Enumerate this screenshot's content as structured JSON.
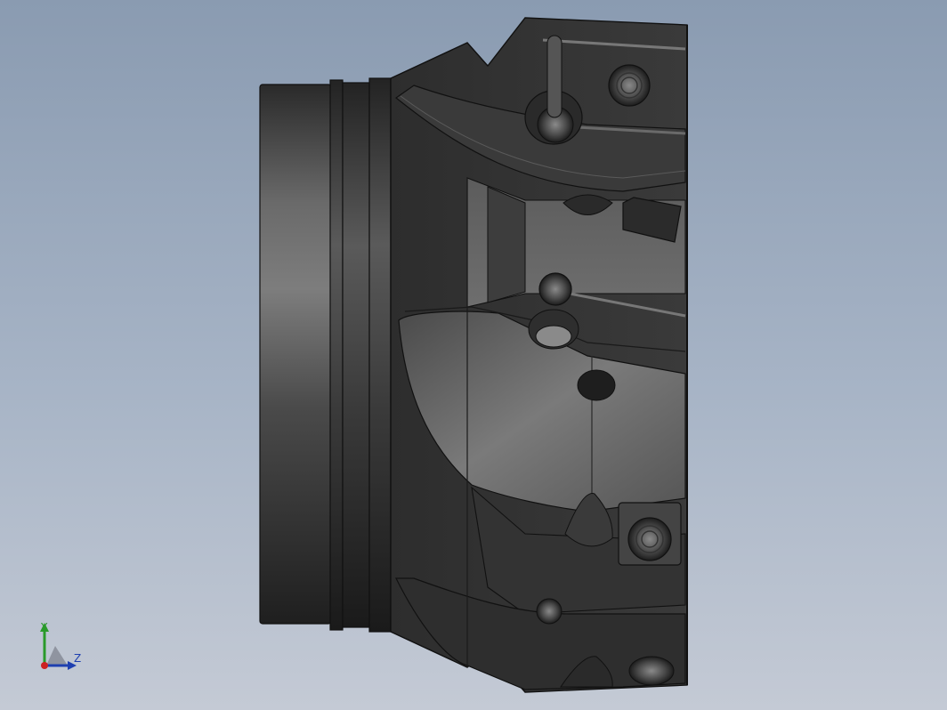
{
  "viewport": {
    "background_top": "#8a9bb1",
    "background_bottom": "#c4cad5",
    "model_color": "#3c3c3c"
  },
  "model": {
    "name": "machined-cutter-body",
    "view": "side",
    "shading": "shaded-with-edges"
  },
  "triad": {
    "y_label": "Y",
    "z_label": "Z",
    "y_color": "#2a9a2a",
    "z_color": "#1e3fb0",
    "origin_color": "#cc2222"
  }
}
